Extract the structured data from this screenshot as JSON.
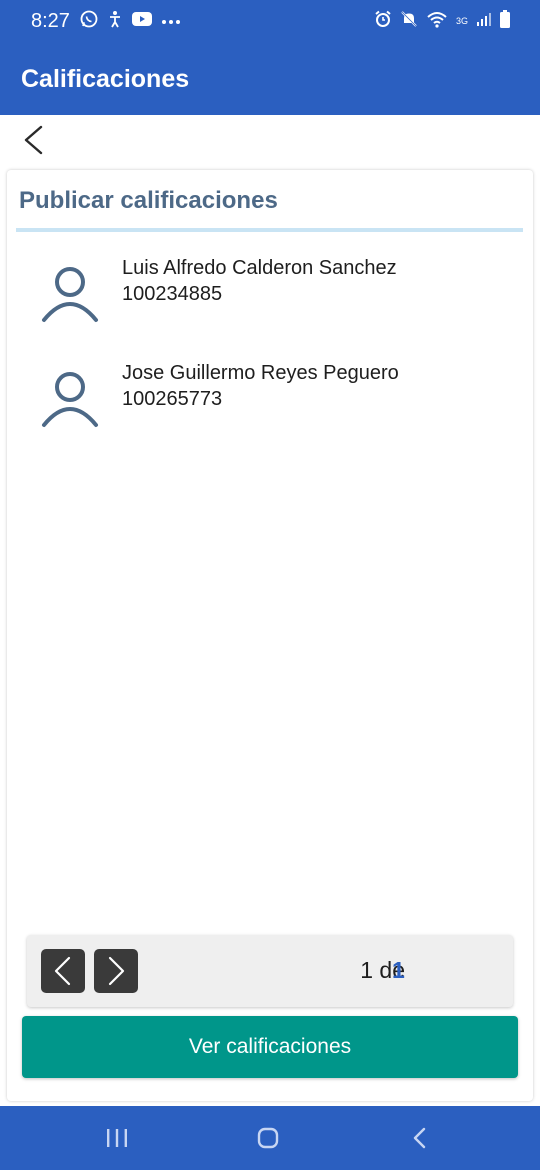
{
  "status_bar": {
    "time": "8:27",
    "left_icons": [
      "whatsapp-icon",
      "accessibility-icon",
      "youtube-icon",
      "more-icon"
    ],
    "right_icons": [
      "alarm-icon",
      "mute-icon",
      "wifi-icon",
      "3g-icon",
      "signal-icon",
      "battery-icon"
    ],
    "network_label": "3G"
  },
  "app_bar": {
    "title": "Calificaciones"
  },
  "back_button": {
    "icon": "chevron-left-icon"
  },
  "card": {
    "title": "Publicar calificaciones",
    "students": [
      {
        "name": "Luis Alfredo Calderon Sanchez",
        "id": "100234885",
        "icon": "person-icon"
      },
      {
        "name": "Jose Guillermo Reyes Peguero",
        "id": "100265773",
        "icon": "person-icon"
      }
    ]
  },
  "pager": {
    "prev_icon": "chevron-left-icon",
    "next_icon": "chevron-right-icon",
    "current_page": "1",
    "separator": "de",
    "total_pages": "1",
    "current_label": "1 de"
  },
  "action_button": {
    "label": "Ver calificaciones"
  },
  "nav_bar": {
    "icons": [
      "recents-icon",
      "home-icon",
      "back-icon"
    ]
  },
  "colors": {
    "primary": "#2b5fc0",
    "accent": "#00968a",
    "card_title": "#4d6987",
    "divider": "#c9e4f4"
  }
}
